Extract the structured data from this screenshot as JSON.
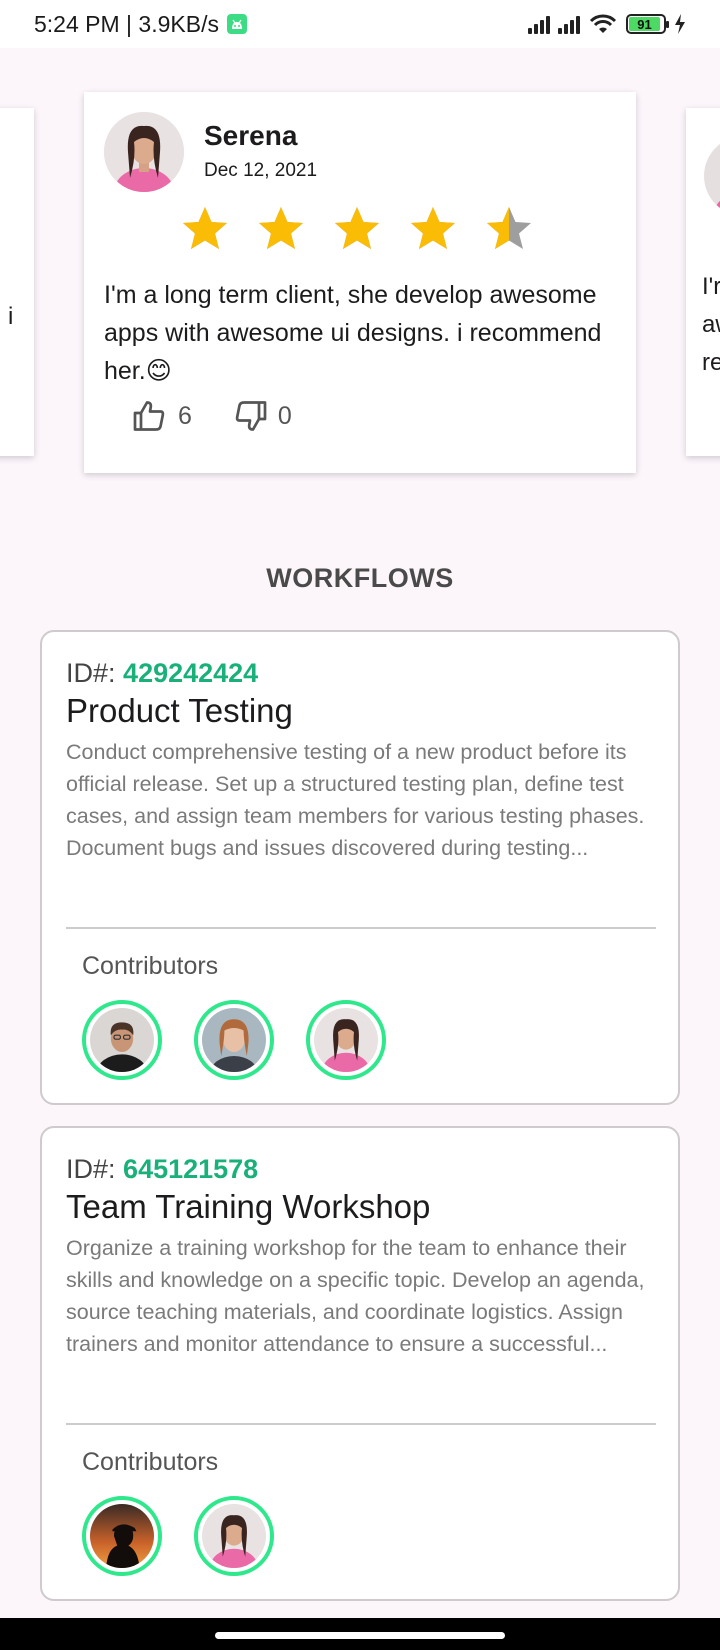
{
  "status_bar": {
    "time_speed": "5:24 PM | 3.9KB/s",
    "battery": "91"
  },
  "reviews": {
    "left_peek_text": "i",
    "right_peek_lines": [
      "I'r",
      "aw",
      "re"
    ],
    "main": {
      "name": "Serena",
      "date": "Dec 12, 2021",
      "rating": 4.5,
      "max_rating": 5,
      "text": "I'm a long term client, she develop awesome apps with awesome ui designs. i recommend her.😊",
      "likes": "6",
      "dislikes": "0"
    }
  },
  "section_title": "WORKFLOWS",
  "workflows": [
    {
      "id_label": "ID#:",
      "id": "429242424",
      "title": "Product Testing",
      "description": "Conduct comprehensive testing of a new product before its official release. Set up a structured testing plan, define test cases, and assign team members for various testing phases. Document bugs and issues discovered during testing...",
      "contributors_label": "Contributors"
    },
    {
      "id_label": "ID#:",
      "id": "645121578",
      "title": "Team Training Workshop",
      "description": "Organize a training workshop for the team to enhance their skills and knowledge on a specific topic. Develop an agenda, source teaching materials, and coordinate logistics. Assign trainers and monitor attendance to ensure a successful...",
      "contributors_label": "Contributors"
    }
  ],
  "colors": {
    "accent_green": "#19b07a",
    "ring_green": "#2fe88b",
    "star_gold": "#fbbc05",
    "star_gray": "#9e9e9e"
  }
}
